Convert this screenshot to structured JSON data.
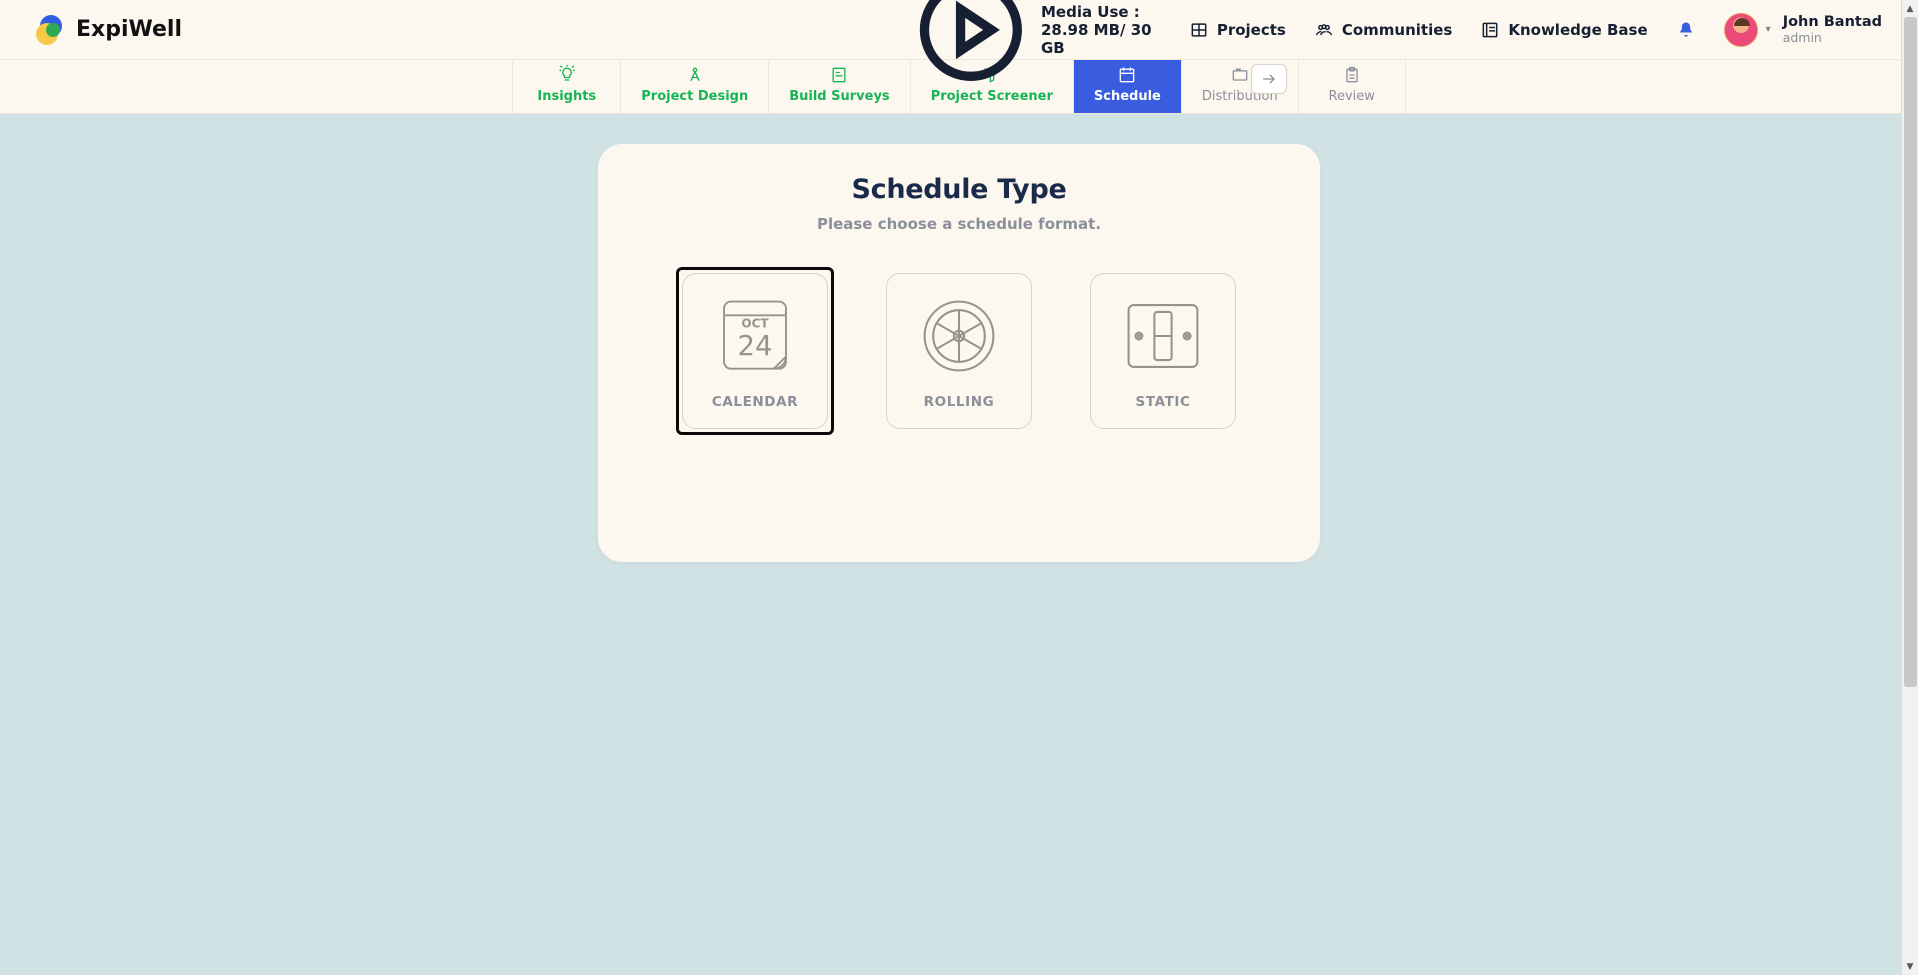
{
  "brand": {
    "name": "ExpiWell"
  },
  "topbar": {
    "media_use_label": "Media Use : 28.98 MB/ 30 GB",
    "links": {
      "projects": "Projects",
      "communities": "Communities",
      "knowledge_base": "Knowledge Base"
    }
  },
  "user": {
    "name": "John Bantad",
    "role": "admin"
  },
  "tabs": [
    {
      "label": "Insights"
    },
    {
      "label": "Project Design"
    },
    {
      "label": "Build Surveys"
    },
    {
      "label": "Project Screener"
    },
    {
      "label": "Schedule"
    },
    {
      "label": "Distribution"
    },
    {
      "label": "Review"
    }
  ],
  "card": {
    "title": "Schedule Type",
    "subtitle": "Please choose a schedule format.",
    "options": [
      {
        "label": "CALENDAR",
        "month": "OCT",
        "day": "24"
      },
      {
        "label": "ROLLING"
      },
      {
        "label": "STATIC"
      }
    ]
  }
}
